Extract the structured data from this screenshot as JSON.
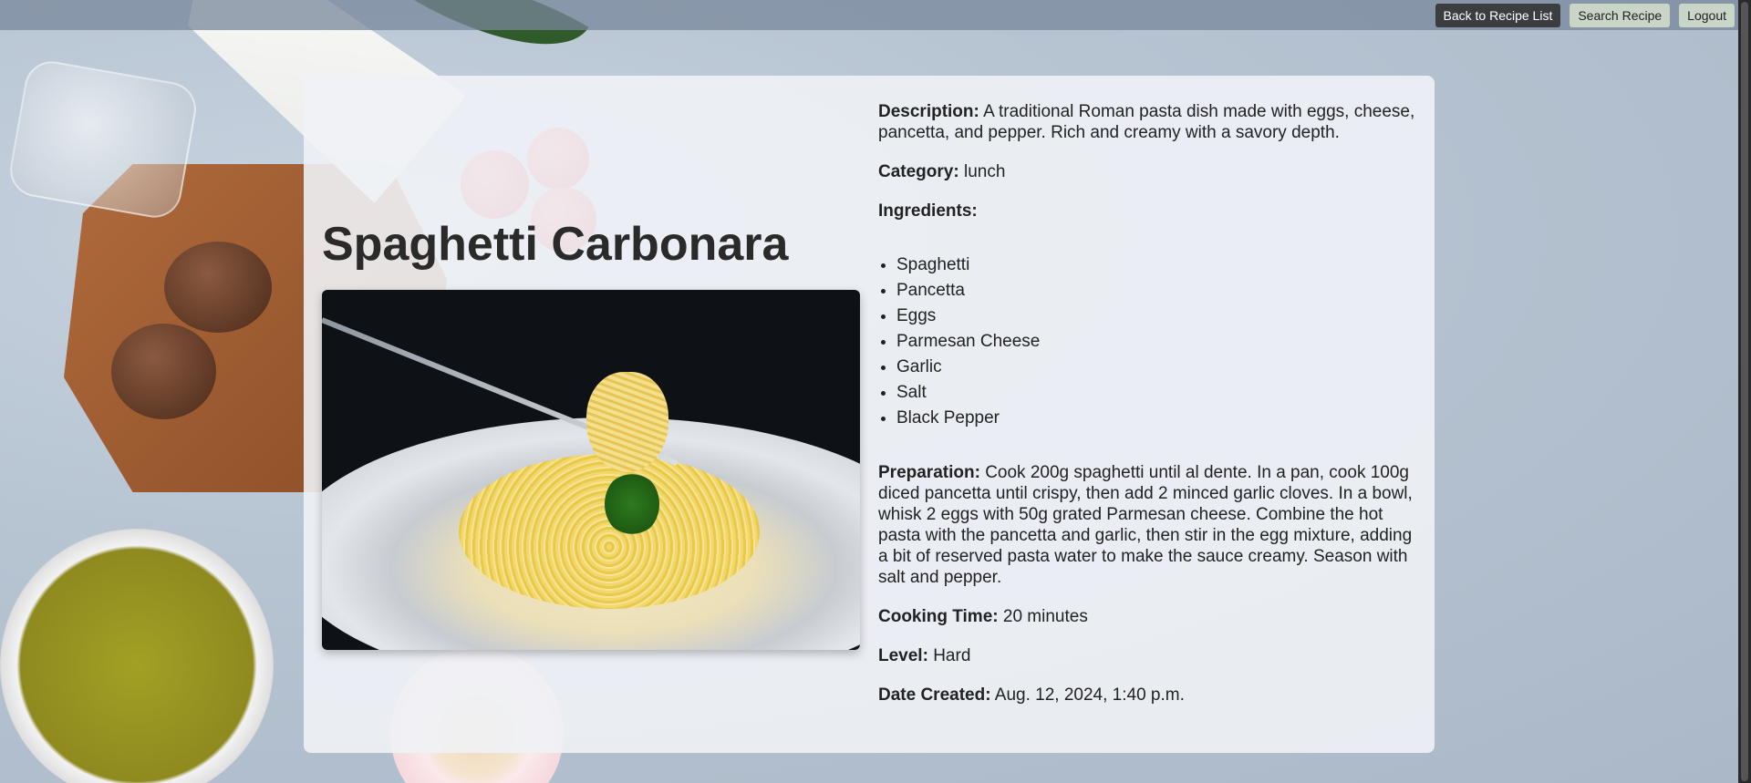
{
  "nav": {
    "back_label": "Back to Recipe List",
    "search_label": "Search Recipe",
    "logout_label": "Logout"
  },
  "recipe": {
    "title": "Spaghetti Carbonara",
    "description_label": "Description:",
    "description": "A traditional Roman pasta dish made with eggs, cheese, pancetta, and pepper. Rich and creamy with a savory depth.",
    "category_label": "Category:",
    "category": "lunch",
    "ingredients_label": "Ingredients:",
    "ingredients": [
      "Spaghetti",
      "Pancetta",
      "Eggs",
      "Parmesan Cheese",
      "Garlic",
      "Salt",
      "Black Pepper"
    ],
    "preparation_label": "Preparation:",
    "preparation": "Cook 200g spaghetti until al dente. In a pan, cook 100g diced pancetta until crispy, then add 2 minced garlic cloves. In a bowl, whisk 2 eggs with 50g grated Parmesan cheese. Combine the hot pasta with the pancetta and garlic, then stir in the egg mixture, adding a bit of reserved pasta water to make the sauce creamy. Season with salt and pepper.",
    "cooking_time_label": "Cooking Time:",
    "cooking_time": "20 minutes",
    "level_label": "Level:",
    "level": "Hard",
    "date_label": "Date Created:",
    "date_created": "Aug. 12, 2024, 1:40 p.m."
  }
}
